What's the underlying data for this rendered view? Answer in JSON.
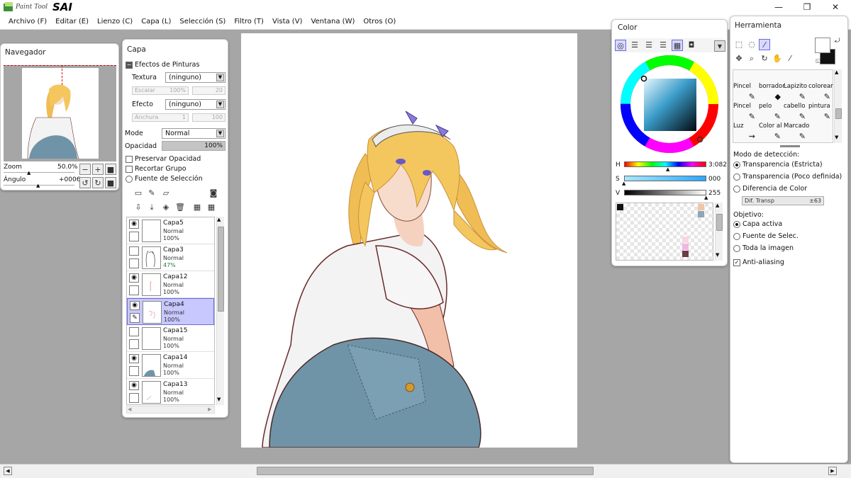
{
  "app": {
    "logo_small": "Paint Tool",
    "logo_big": "SAI"
  },
  "window_controls": {
    "minimize": "—",
    "maximize": "❐",
    "close": "✕"
  },
  "menu": [
    "Archivo (F)",
    "Editar (E)",
    "Lienzo (C)",
    "Capa (L)",
    "Selección (S)",
    "Filtro (T)",
    "Vista (V)",
    "Ventana (W)",
    "Otros (O)"
  ],
  "navigator": {
    "title": "Navegador",
    "zoom_label": "Zoom",
    "zoom_value": "50.0%",
    "angle_label": "Ángulo",
    "angle_value": "+0006"
  },
  "layer_panel": {
    "title": "Capa",
    "effects_header": "Efectos de Pinturas",
    "texture_label": "Textura",
    "texture_value": "(ninguno)",
    "scale_label": "Escalar",
    "scale_value": "100%",
    "scale_value2": "20",
    "effect_label": "Efecto",
    "effect_value": "(ninguno)",
    "width_label": "Anchura",
    "width_value": "1",
    "width_value2": "100",
    "mode_label": "Mode",
    "mode_value": "Normal",
    "opacity_label": "Opacidad",
    "opacity_value": "100%",
    "preserve_opacity": "Preservar Opacidad",
    "clip_group": "Recortar Grupo",
    "selection_source": "Fuente de Selección",
    "layers": [
      {
        "name": "Capa5",
        "mode": "Normal",
        "opacity": "100%",
        "visible": true
      },
      {
        "name": "Capa3",
        "mode": "Normal",
        "opacity": "47%",
        "visible": false
      },
      {
        "name": "Capa12",
        "mode": "Normal",
        "opacity": "100%",
        "visible": true
      },
      {
        "name": "Capa4",
        "mode": "Normal",
        "opacity": "100%",
        "visible": true
      },
      {
        "name": "Capa15",
        "mode": "Normal",
        "opacity": "100%",
        "visible": false
      },
      {
        "name": "Capa14",
        "mode": "Normal",
        "opacity": "100%",
        "visible": true
      },
      {
        "name": "Capa13",
        "mode": "Normal",
        "opacity": "100%",
        "visible": true
      }
    ]
  },
  "color_panel": {
    "title": "Color",
    "h_label": "H",
    "h_value": "3:082",
    "s_label": "S",
    "s_value": "000",
    "v_label": "V",
    "v_value": "255",
    "swatches": [
      "#111111",
      "#f2c4a8",
      "#8fa6b4",
      "#f6d8de",
      "#f2b6e0",
      "#6a3c48"
    ]
  },
  "tool_panel": {
    "title": "Herramienta",
    "tools": [
      {
        "label": "Pincel",
        "icon": "✎"
      },
      {
        "label": "borrador",
        "icon": "◆"
      },
      {
        "label": "Lapizito",
        "icon": "✎"
      },
      {
        "label": "colorear",
        "icon": "✎"
      },
      {
        "label": "Pincel",
        "icon": "✎"
      },
      {
        "label": "pelo",
        "icon": "✎"
      },
      {
        "label": "cabello",
        "icon": "✎"
      },
      {
        "label": "pintura",
        "icon": "✎"
      },
      {
        "label": "Luz",
        "icon": "⇝"
      },
      {
        "label": "Color al",
        "icon": "✎"
      },
      {
        "label": "Marcado",
        "icon": "✎"
      }
    ],
    "detection_label": "Modo de detección:",
    "detection_options": [
      "Transparencia (Estricta)",
      "Transparencia (Poco definida)",
      "Diferencia de Color"
    ],
    "dif_label": "Dif. Transp",
    "dif_value": "±63",
    "target_label": "Objetivo:",
    "target_options": [
      "Capa activa",
      "Fuente de Selec.",
      "Toda la imagen"
    ],
    "antialias_label": "Anti-aliasing"
  },
  "colors": {
    "accent_selected_layer": "#c8c8ff",
    "hair": "#f2c35a",
    "shirt": "#f4f4f4",
    "jeans": "#6f94a8"
  }
}
